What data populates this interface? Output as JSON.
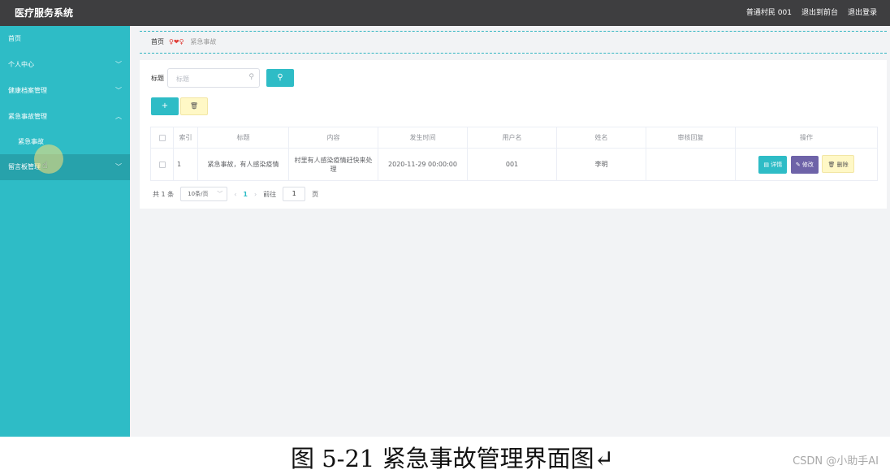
{
  "app": {
    "title": "医疗服务系统",
    "user": "普通村民 001",
    "to_front": "退出到前台",
    "logout": "退出登录"
  },
  "colors": {
    "topbar": "#3e3e40",
    "sidebar": "#2ebcc6",
    "accent": "#2ebcc6",
    "edit": "#6e63a8",
    "delete": "#fff8c6"
  },
  "sidebar": {
    "items": [
      {
        "label": "首页"
      },
      {
        "label": "个人中心",
        "chevron": "chevron-down"
      },
      {
        "label": "健康档案管理",
        "chevron": "chevron-down"
      },
      {
        "label": "紧急事故管理",
        "chevron": "chevron-up"
      },
      {
        "label": "紧急事故"
      },
      {
        "label": "留言板管理",
        "chevron": "chevron-down"
      }
    ]
  },
  "breadcrumb": {
    "home": "首页",
    "logo_text": "♀❤♀",
    "current": "紧急事故"
  },
  "search": {
    "label": "标题",
    "placeholder": "标题",
    "icon": "search-icon",
    "button_icon": "search-icon"
  },
  "actions": {
    "add_icon": "+",
    "delete_icon": "trash-icon"
  },
  "table": {
    "headers": [
      "索引",
      "标题",
      "内容",
      "发生时间",
      "用户名",
      "姓名",
      "审核回复",
      "操作"
    ],
    "rows": [
      {
        "index": "1",
        "title": "紧急事故，有人感染疫情",
        "content": "村里有人感染疫情赶快来处理",
        "time": "2020-11-29 00:00:00",
        "username": "001",
        "name": "李明",
        "review": "",
        "detail": "详情",
        "edit": "修改",
        "delete": "删除"
      }
    ]
  },
  "pagination": {
    "total": "共 1 条",
    "page_size": "10条/页",
    "prev": "‹",
    "current_page": "1",
    "next": "›",
    "goto": "前往",
    "goto_value": "1",
    "page_suffix": "页"
  },
  "caption": {
    "text": "图 5-21 紧急事故管理界面图↵",
    "watermark": "CSDN @小助手AI"
  }
}
